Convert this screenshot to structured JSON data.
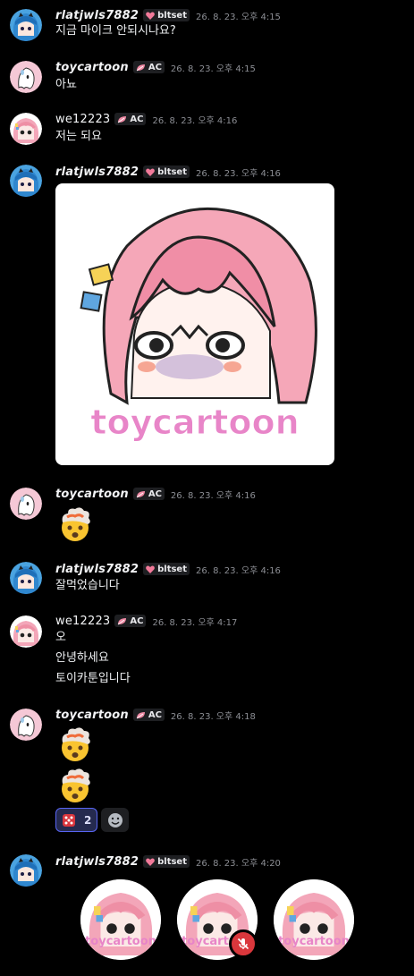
{
  "users": {
    "rlatjwls": {
      "name": "rlatjwls7882",
      "tag": "bltset",
      "tag_icon": "heart-icon"
    },
    "toycartoon": {
      "name": "toycartoon",
      "tag": "AC",
      "tag_icon": "leaf-icon"
    },
    "we12223": {
      "name": "we12223",
      "tag": "AC",
      "tag_icon": "leaf-icon"
    }
  },
  "messages": [
    {
      "author": "rlatjwls",
      "time": "26. 8. 23. 오후 4:15",
      "lines": [
        "지금 마이크 안되시나요?"
      ]
    },
    {
      "author": "toycartoon",
      "time": "26. 8. 23. 오후 4:15",
      "lines": [
        "아뇨"
      ]
    },
    {
      "author": "we12223",
      "time": "26. 8. 23. 오후 4:16",
      "lines": [
        "저는 되요"
      ]
    },
    {
      "author": "rlatjwls",
      "time": "26. 8. 23. 오후 4:16",
      "sticker_text": "toycartoon"
    },
    {
      "author": "toycartoon",
      "time": "26. 8. 23. 오후 4:16",
      "emoji": [
        "exploding-head-emoji"
      ]
    },
    {
      "author": "rlatjwls",
      "time": "26. 8. 23. 오후 4:16",
      "lines": [
        "잘먹었습니다"
      ]
    },
    {
      "author": "we12223",
      "time": "26. 8. 23. 오후 4:17",
      "lines": [
        "오",
        "안녕하세요",
        "토이카툰입니다"
      ]
    },
    {
      "author": "toycartoon",
      "time": "26. 8. 23. 오후 4:18",
      "emoji": [
        "exploding-head-emoji",
        "exploding-head-emoji"
      ],
      "reaction": {
        "emoji": "dice-icon",
        "count": "2"
      }
    },
    {
      "author": "rlatjwls",
      "time": "26. 8. 23. 오후 4:20",
      "voice_watermark": "toycartoon"
    }
  ],
  "colors": {
    "background": "#000000",
    "accent": "#5865f2",
    "mute_red": "#da373c",
    "timestamp": "#8c8e94"
  }
}
